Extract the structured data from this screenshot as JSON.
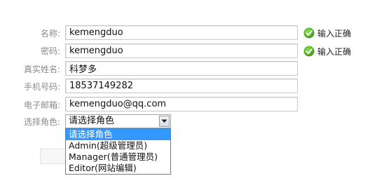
{
  "fields": [
    {
      "label": "名称:",
      "value": "kemengduo",
      "status": "输入正确"
    },
    {
      "label": "密码:",
      "value": "kemengduo",
      "status": "输入正确"
    },
    {
      "label": "真实姓名:",
      "value": "科梦多"
    },
    {
      "label": "手机号码:",
      "value": "18537149282"
    },
    {
      "label": "电子邮箱:",
      "value": "kemengduo@qq.com"
    }
  ],
  "role": {
    "label": "选择角色:",
    "selected": "请选择角色",
    "options": [
      "请选择角色",
      "Admin(超级管理员)",
      "Manager(普通管理员)",
      "Editor(网站编辑)"
    ]
  },
  "colors": {
    "label": "#8a8a8a",
    "check": "#4caf1a",
    "option_highlight": "#3399ff"
  },
  "icons": {
    "status": "check-circle-icon",
    "select": "chevron-down-icon"
  }
}
